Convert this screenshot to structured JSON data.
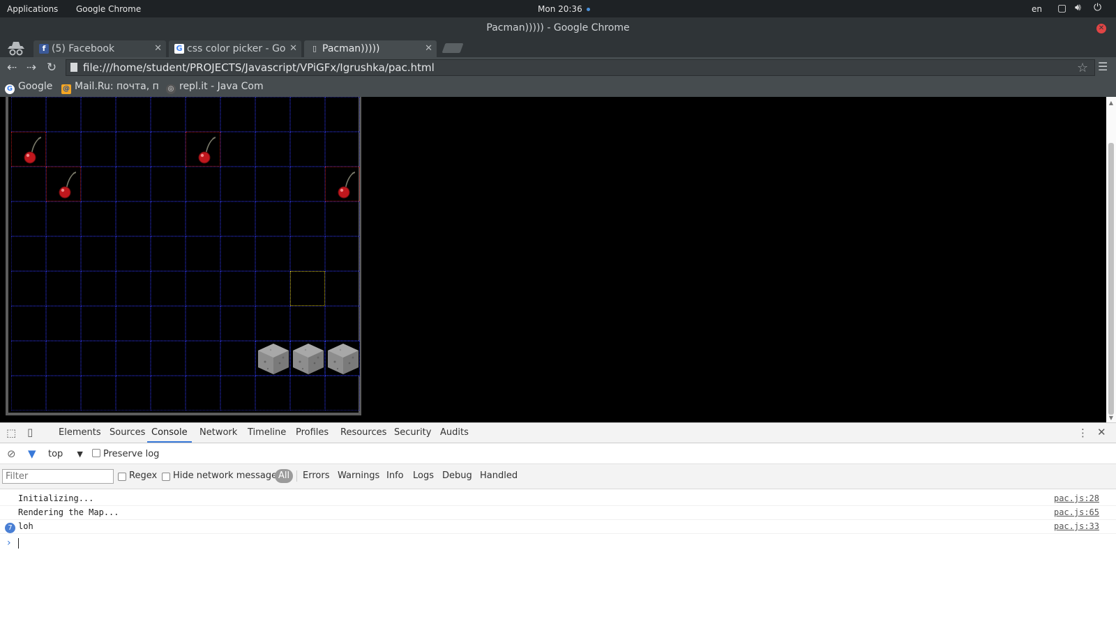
{
  "gnome": {
    "applications": "Applications",
    "app_name": "Google Chrome",
    "clock": "Mon 20:36",
    "lang": "en"
  },
  "window": {
    "title": "Pacman))))) - Google Chrome"
  },
  "tabs": [
    {
      "label": "(5) Facebook",
      "icon": "facebook-icon",
      "icon_color": "#3b5998"
    },
    {
      "label": "css color picker - Go",
      "icon": "google-icon",
      "icon_color": "#ffffff"
    },
    {
      "label": "Pacman)))))",
      "icon": "page-icon",
      "icon_color": "#d6d9db",
      "active": true
    }
  ],
  "omnibox": {
    "url": "file:///home/student/PROJECTS/Javascript/VPiGFx/Igrushka/pac.html"
  },
  "bookmarks": [
    {
      "label": "Google",
      "icon": "google-icon"
    },
    {
      "label": "Mail.Ru: почта, п",
      "icon": "mailru-icon"
    },
    {
      "label": "repl.it - Java Com",
      "icon": "replit-icon"
    }
  ],
  "game": {
    "cells": [
      {
        "col": 0,
        "row": 1,
        "kind": "cherry"
      },
      {
        "col": 5,
        "row": 1,
        "kind": "cherry"
      },
      {
        "col": 1,
        "row": 2,
        "kind": "cherry"
      },
      {
        "col": 9,
        "row": 2,
        "kind": "cherry"
      },
      {
        "col": 8,
        "row": 5,
        "kind": "target"
      },
      {
        "col": 7,
        "row": 7,
        "kind": "wall"
      },
      {
        "col": 8,
        "row": 7,
        "kind": "wall"
      },
      {
        "col": 9,
        "row": 7,
        "kind": "wall"
      }
    ],
    "colors": {
      "grid": "#1b1f8a",
      "cherry_border": "#b01818",
      "target_border": "#c8b400",
      "wall_border": "#2430c0"
    }
  },
  "devtools": {
    "tabs": [
      "Elements",
      "Sources",
      "Console",
      "Network",
      "Timeline",
      "Profiles",
      "Resources",
      "Security",
      "Audits"
    ],
    "active_tab": "Console",
    "context": "top",
    "preserve_log": "Preserve log",
    "filter_placeholder": "Filter",
    "regex": "Regex",
    "hide_network": "Hide network messages",
    "levels": [
      "All",
      "Errors",
      "Warnings",
      "Info",
      "Logs",
      "Debug",
      "Handled"
    ],
    "console": [
      {
        "msg": "Initializing...",
        "src": "pac.js:28"
      },
      {
        "msg": "Rendering the Map...",
        "src": "pac.js:65"
      },
      {
        "msg": "loh",
        "src": "pac.js:33",
        "count": "7"
      }
    ]
  }
}
